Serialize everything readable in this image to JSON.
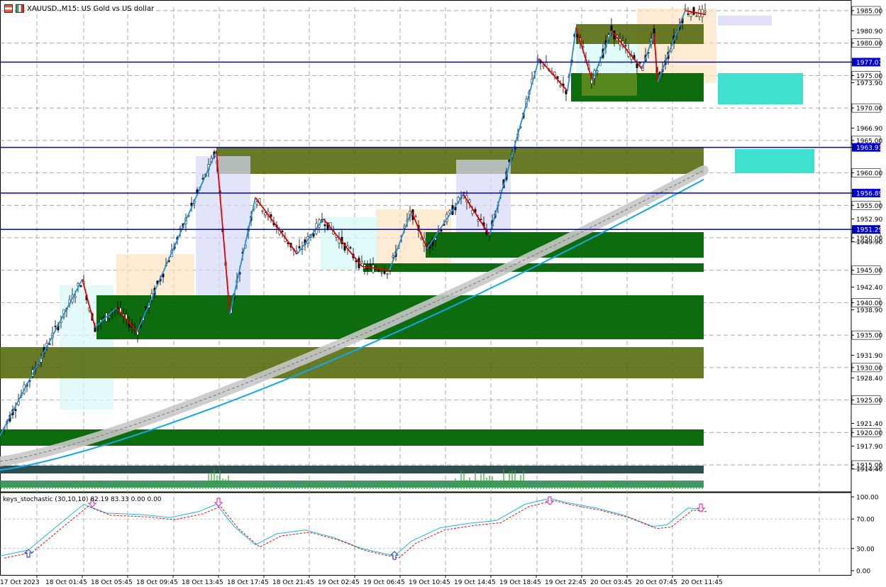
{
  "title": "XAUUSD.,M15:  US Gold vs US dollar",
  "indicator_label": "keys_stochastic (30,10,10) 82.19 83.33 0.00 0.00",
  "colors": {
    "up_line": "#1e90e0",
    "down_line": "#e00000",
    "hline": "#0000cc",
    "ma_grey": "#c8c8c8",
    "ma_blue": "#12a7ea",
    "stoch_main": "#1fb7e0",
    "stoch_sig": "#e01010",
    "zone_dark": "#006400",
    "zone_olive": "#556b0f",
    "zone_teal": "#40e0d0"
  },
  "chart_data": {
    "type": "line",
    "price_axis_labels": [
      "1985.00",
      "1980.90",
      "1980.00",
      "1977.07",
      "1975.00",
      "1973.90",
      "1970.00",
      "1966.90",
      "1965.00",
      "1963.93",
      "1960.00",
      "1956.89",
      "1955.00",
      "1952.90",
      "1951.29",
      "1950.00",
      "1949.90",
      "1945.00",
      "1942.40",
      "1940.00",
      "1938.90",
      "1935.00",
      "1931.90",
      "1930.00",
      "1928.40",
      "1925.00",
      "1921.40",
      "1920.00",
      "1917.90",
      "1915.00",
      "1914.40"
    ],
    "price_tick_values": [
      1985,
      1981.9,
      1980,
      1977.07,
      1975,
      1973.9,
      1970,
      1966.9,
      1965,
      1963.93,
      1960,
      1956.89,
      1955,
      1952.9,
      1951.29,
      1950,
      1949.4,
      1945,
      1942.4,
      1940,
      1938.9,
      1935,
      1931.9,
      1930,
      1928.4,
      1925,
      1921.4,
      1920,
      1917.9,
      1915,
      1914.4
    ],
    "horizontal_lines": [
      1977.07,
      1963.93,
      1956.89,
      1951.29
    ],
    "time_labels": [
      "17 Oct 2023",
      "18 Oct 01:45",
      "18 Oct 05:45",
      "18 Oct 09:45",
      "18 Oct 13:45",
      "18 Oct 17:45",
      "18 Oct 21:45",
      "19 Oct 02:45",
      "19 Oct 06:45",
      "19 Oct 10:45",
      "19 Oct 14:45",
      "19 Oct 18:45",
      "19 Oct 22:45",
      "20 Oct 03:45",
      "20 Oct 07:45",
      "20 Oct 11:45"
    ],
    "zigzag": [
      [
        0,
        1919.5
      ],
      [
        116,
        1943.6
      ],
      [
        134,
        1936.2
      ],
      [
        164,
        1939.2
      ],
      [
        193,
        1935.5
      ],
      [
        305,
        1963.4
      ],
      [
        324,
        1938.2
      ],
      [
        360,
        1956.2
      ],
      [
        419,
        1947.5
      ],
      [
        456,
        1952.9
      ],
      [
        510,
        1945.6
      ],
      [
        549,
        1945.0
      ],
      [
        580,
        1954.1
      ],
      [
        602,
        1948.3
      ],
      [
        653,
        1956.7
      ],
      [
        690,
        1950.4
      ],
      [
        760,
        1977.6
      ],
      [
        800,
        1972.6
      ],
      [
        812,
        1982.4
      ],
      [
        835,
        1974.2
      ],
      [
        862,
        1981.9
      ],
      [
        905,
        1976.0
      ],
      [
        922,
        1981.5
      ],
      [
        927,
        1974.0
      ],
      [
        966,
        1985.0
      ],
      [
        995,
        1984.4
      ]
    ],
    "stochastic": {
      "ylim": [
        0,
        100
      ],
      "ticks": [
        "100.00",
        "70.00",
        "30.00",
        "0.00"
      ],
      "tick_values": [
        100,
        70,
        30,
        0
      ],
      "main": 82.19,
      "signal": 83.33
    }
  }
}
